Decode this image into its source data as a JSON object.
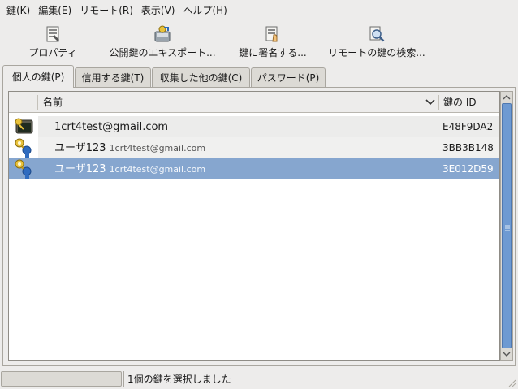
{
  "menubar": {
    "items": [
      "鍵(K)",
      "編集(E)",
      "リモート(R)",
      "表示(V)",
      "ヘルプ(H)"
    ]
  },
  "toolbar": {
    "properties": "プロパティ",
    "export": "公開鍵のエキスポート...",
    "sign": "鍵に署名する...",
    "search": "リモートの鍵の検索..."
  },
  "tabs": [
    "個人の鍵(P)",
    "信用する鍵(T)",
    "収集した他の鍵(C)",
    "パスワード(P)"
  ],
  "table": {
    "columns": {
      "name": "名前",
      "key_id": "鍵の ID"
    },
    "rows": [
      {
        "name": "1crt4test@gmail.com",
        "sub": "",
        "key_id": "E48F9DA2",
        "icon": "secret-key-icon"
      },
      {
        "name": "ユーザ123",
        "sub": "1crt4test@gmail.com",
        "key_id": "3BB3B148",
        "icon": "key-pair-icon"
      },
      {
        "name": "ユーザ123",
        "sub": "1crt4test@gmail.com",
        "key_id": "3E012D59",
        "icon": "key-pair-icon"
      }
    ]
  },
  "status": {
    "text": "1個の鍵を選択しました"
  },
  "colors": {
    "selection": "#86a6cf",
    "scrollbar_thumb": "#6e9ad2"
  }
}
